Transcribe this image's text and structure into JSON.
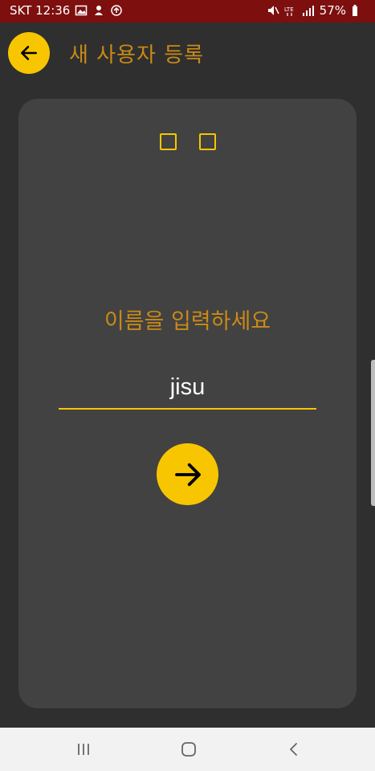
{
  "status_bar": {
    "carrier_time": "SKT 12:36",
    "battery": "57%",
    "network": "LTE",
    "icons": [
      "gallery-icon",
      "notification-icon",
      "sync-icon",
      "mute-icon",
      "lte-icon",
      "signal-icon",
      "battery-icon"
    ]
  },
  "app_bar": {
    "title": "새 사용자 등록",
    "back_icon": "arrow-left-icon"
  },
  "card": {
    "steps": [
      {
        "state": "empty"
      },
      {
        "state": "empty"
      }
    ],
    "prompt": "이름을 입력하세요",
    "name_value": "jisu",
    "next_icon": "arrow-right-icon"
  },
  "nav_bar": {
    "items": [
      "recents-icon",
      "home-icon",
      "back-icon"
    ]
  },
  "colors": {
    "status_bar": "#7d0f0f",
    "background": "#2f2f2f",
    "card": "#424242",
    "accent": "#f7c600",
    "title_text": "#c98a16",
    "nav_bar": "#f2f2f2"
  }
}
